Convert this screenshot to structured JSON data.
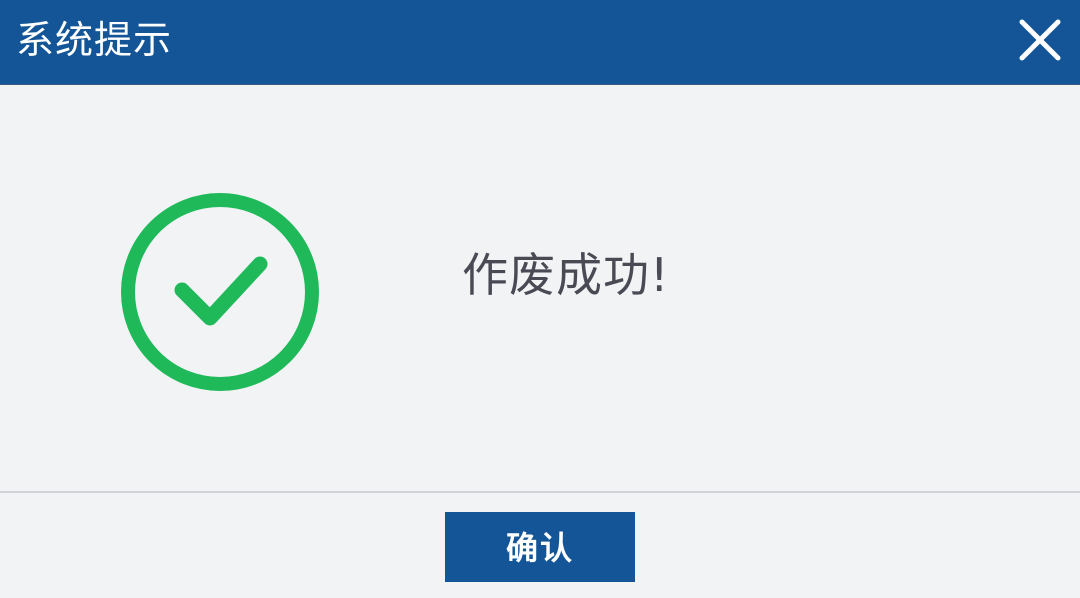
{
  "dialog": {
    "title": "系统提示",
    "close_icon": "close-icon",
    "message": "作废成功!",
    "status_icon": "success-check-icon",
    "confirm_label": "确认"
  },
  "colors": {
    "titlebar": "#135597",
    "background": "#f2f3f5",
    "success": "#1fb95a",
    "button": "#135597",
    "message_text": "#4a4a55"
  }
}
